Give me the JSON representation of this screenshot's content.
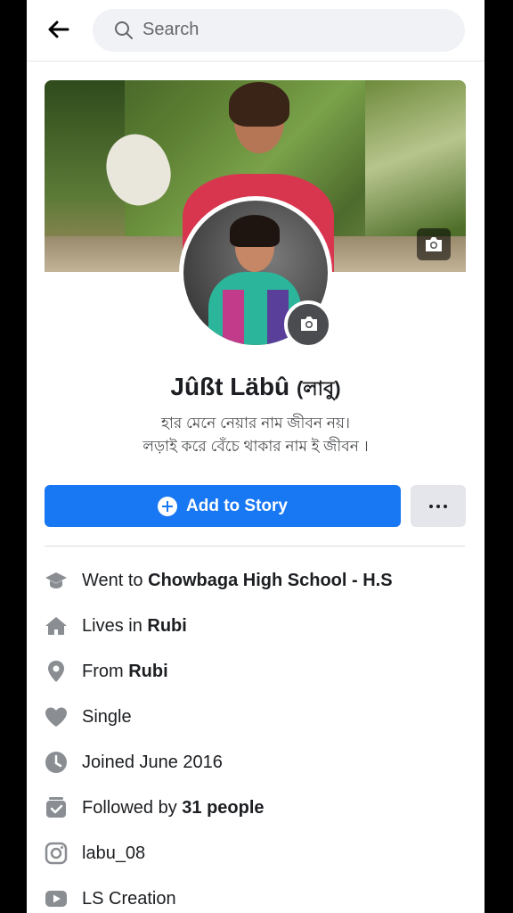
{
  "header": {
    "search_placeholder": "Search",
    "back_icon": "arrow-left-icon",
    "search_icon": "magnifier-icon"
  },
  "profile": {
    "name": "Jûßt Läbû",
    "name_suffix": "(লাবু)",
    "bio_line1": "হার মেনে নেয়ার নাম জীবন নয়।",
    "bio_line2": "লড়াই করে বেঁচে থাকার নাম ই জীবন ।"
  },
  "actions": {
    "add_story_label": "Add to Story",
    "more_label": "..."
  },
  "details": [
    {
      "icon": "graduation-cap-icon",
      "prefix": "Went to ",
      "bold": "Chowbaga High School - H.S"
    },
    {
      "icon": "home-icon",
      "prefix": "Lives in ",
      "bold": "Rubi"
    },
    {
      "icon": "location-pin-icon",
      "prefix": "From ",
      "bold": "Rubi"
    },
    {
      "icon": "heart-icon",
      "prefix": "Single",
      "bold": ""
    },
    {
      "icon": "clock-icon",
      "prefix": "Joined June 2016",
      "bold": ""
    },
    {
      "icon": "followers-icon",
      "prefix": "Followed by ",
      "bold": "31 people"
    },
    {
      "icon": "instagram-icon",
      "prefix": "labu_08",
      "bold": ""
    },
    {
      "icon": "youtube-icon",
      "prefix": "LS Creation",
      "bold": ""
    }
  ],
  "colors": {
    "accent": "#1877f2",
    "icon_grey": "#8a8d91",
    "text": "#1c1e21"
  }
}
